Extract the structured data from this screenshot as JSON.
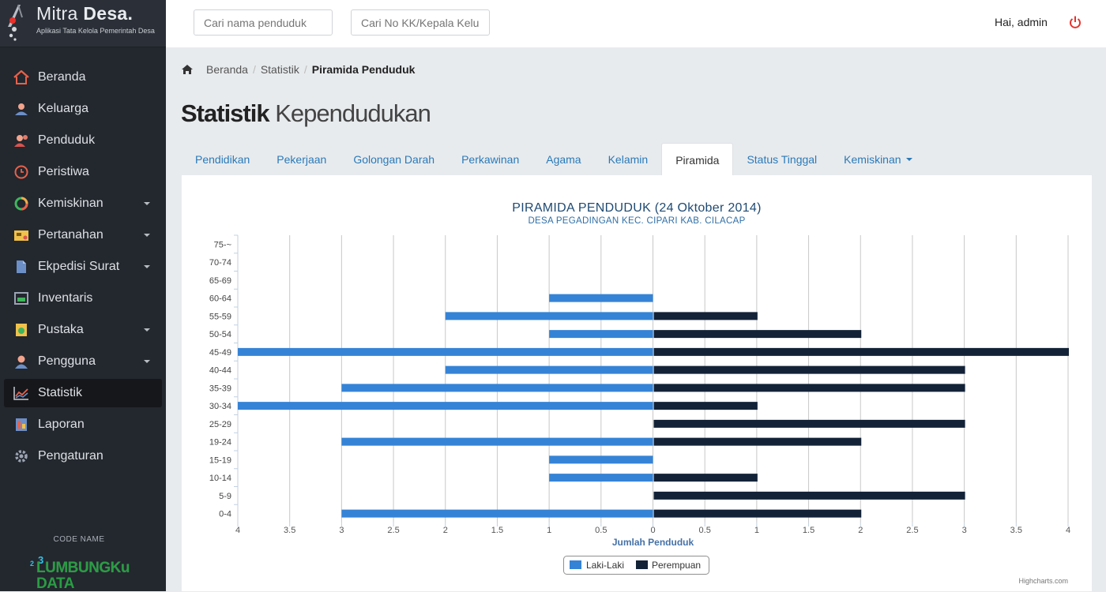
{
  "brand": {
    "name_light": "Mitra ",
    "name_bold": "Desa.",
    "subtitle": "Aplikasi Tata Kelola Pemerintah Desa"
  },
  "sidebar": {
    "items": [
      {
        "label": "Beranda",
        "icon": "home-icon",
        "dropdown": false
      },
      {
        "label": "Keluarga",
        "icon": "family-icon",
        "dropdown": false
      },
      {
        "label": "Penduduk",
        "icon": "people-icon",
        "dropdown": false
      },
      {
        "label": "Peristiwa",
        "icon": "clock-icon",
        "dropdown": false
      },
      {
        "label": "Kemiskinan",
        "icon": "pie-icon",
        "dropdown": true
      },
      {
        "label": "Pertanahan",
        "icon": "land-icon",
        "dropdown": true
      },
      {
        "label": "Ekpedisi Surat",
        "icon": "document-icon",
        "dropdown": true
      },
      {
        "label": "Inventaris",
        "icon": "inventory-icon",
        "dropdown": false
      },
      {
        "label": "Pustaka",
        "icon": "book-icon",
        "dropdown": true
      },
      {
        "label": "Pengguna",
        "icon": "user-icon",
        "dropdown": true
      },
      {
        "label": "Statistik",
        "icon": "chart-icon",
        "dropdown": false,
        "active": true
      },
      {
        "label": "Laporan",
        "icon": "report-icon",
        "dropdown": false
      },
      {
        "label": "Pengaturan",
        "icon": "gear-icon",
        "dropdown": false
      }
    ],
    "codename_label": "CODE NAME",
    "codename": {
      "sup": "2",
      "sup3": "3",
      "line1a": "LUMBUNG",
      "line1b": "Ku",
      "line2": "DATA"
    }
  },
  "topbar": {
    "search_penduduk_placeholder": "Cari nama penduduk",
    "search_kk_placeholder": "Cari No KK/Kepala Keluarga",
    "greeting": "Hai, admin"
  },
  "breadcrumb": {
    "home": "Beranda",
    "section": "Statistik",
    "current": "Piramida Penduduk",
    "separator": "/"
  },
  "page": {
    "title_bold": "Statistik",
    "title_light": " Kependudukan"
  },
  "tabs": [
    {
      "label": "Pendidikan"
    },
    {
      "label": "Pekerjaan"
    },
    {
      "label": "Golongan Darah"
    },
    {
      "label": "Perkawinan"
    },
    {
      "label": "Agama"
    },
    {
      "label": "Kelamin"
    },
    {
      "label": "Piramida",
      "active": true
    },
    {
      "label": "Status Tinggal"
    },
    {
      "label": "Kemiskinan",
      "dropdown": true
    }
  ],
  "colors": {
    "male": "#3583d6",
    "female": "#132237",
    "title": "#1f4a72",
    "subtitle": "#2f6fa6",
    "axis_title": "#4572a7",
    "power": "#e8312b"
  },
  "chart_data": {
    "type": "bar",
    "orientation": "horizontal-pyramid",
    "title": "PIRAMIDA PENDUDUK (24 Oktober 2014)",
    "subtitle": "DESA PEGADINGAN KEC. CIPARI KAB. CILACAP",
    "xlabel": "Jumlah Penduduk",
    "xlim": [
      -4,
      4
    ],
    "xticks": [
      "4",
      "3.5",
      "3",
      "2.5",
      "2",
      "1.5",
      "1",
      "0.5",
      "0",
      "0.5",
      "1",
      "1.5",
      "2",
      "2.5",
      "3",
      "3.5",
      "4"
    ],
    "categories": [
      "75-~",
      "70-74",
      "65-69",
      "60-64",
      "55-59",
      "50-54",
      "45-49",
      "40-44",
      "35-39",
      "30-34",
      "25-29",
      "19-24",
      "15-19",
      "10-14",
      "5-9",
      "0-4"
    ],
    "series": [
      {
        "name": "Laki-Laki",
        "values": [
          0,
          0,
          0,
          1,
          2,
          1,
          4,
          2,
          3,
          4,
          0,
          3,
          1,
          1,
          0,
          3
        ]
      },
      {
        "name": "Perempuan",
        "values": [
          0,
          0,
          0,
          0,
          1,
          2,
          4,
          3,
          3,
          1,
          3,
          2,
          0,
          1,
          3,
          2
        ]
      }
    ],
    "legend": "bottom-center",
    "grid": true,
    "credits": "Highcharts.com"
  }
}
